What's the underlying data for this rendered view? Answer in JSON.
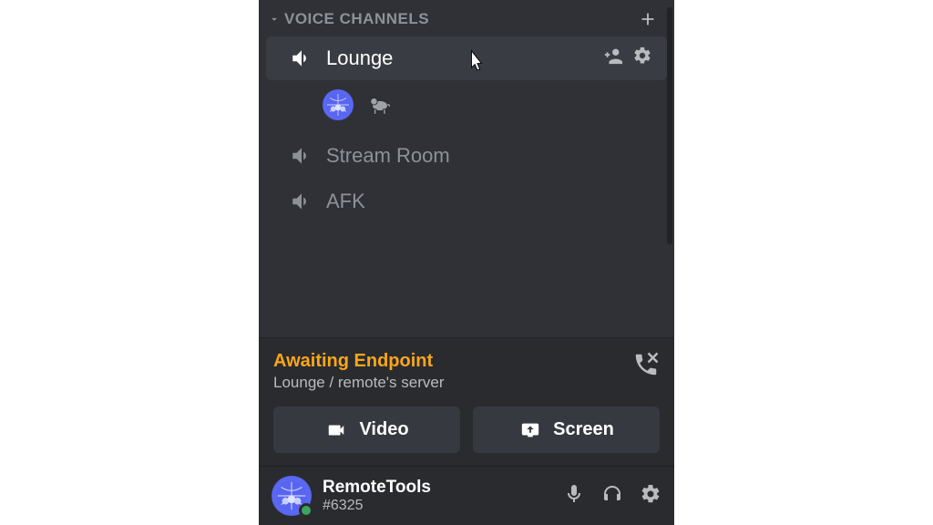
{
  "colors": {
    "panel_bg": "#2f3136",
    "secondary_bg": "#292b2f",
    "hover_bg": "#393c43",
    "text_muted": "#8e9297",
    "text_normal": "#dcddde",
    "accent_warning": "#faa61a",
    "online": "#3ba55d"
  },
  "section": {
    "title": "VOICE CHANNELS"
  },
  "channels": [
    {
      "name": "Lounge",
      "active": true,
      "members_shown": true
    },
    {
      "name": "Stream Room",
      "active": false
    },
    {
      "name": "AFK",
      "active": false
    }
  ],
  "voice_status": {
    "state": "Awaiting Endpoint",
    "location": "Lounge / remote's server",
    "buttons": {
      "video": "Video",
      "screen": "Screen"
    }
  },
  "user": {
    "name": "RemoteTools",
    "discriminator": "#6325",
    "status": "online"
  }
}
